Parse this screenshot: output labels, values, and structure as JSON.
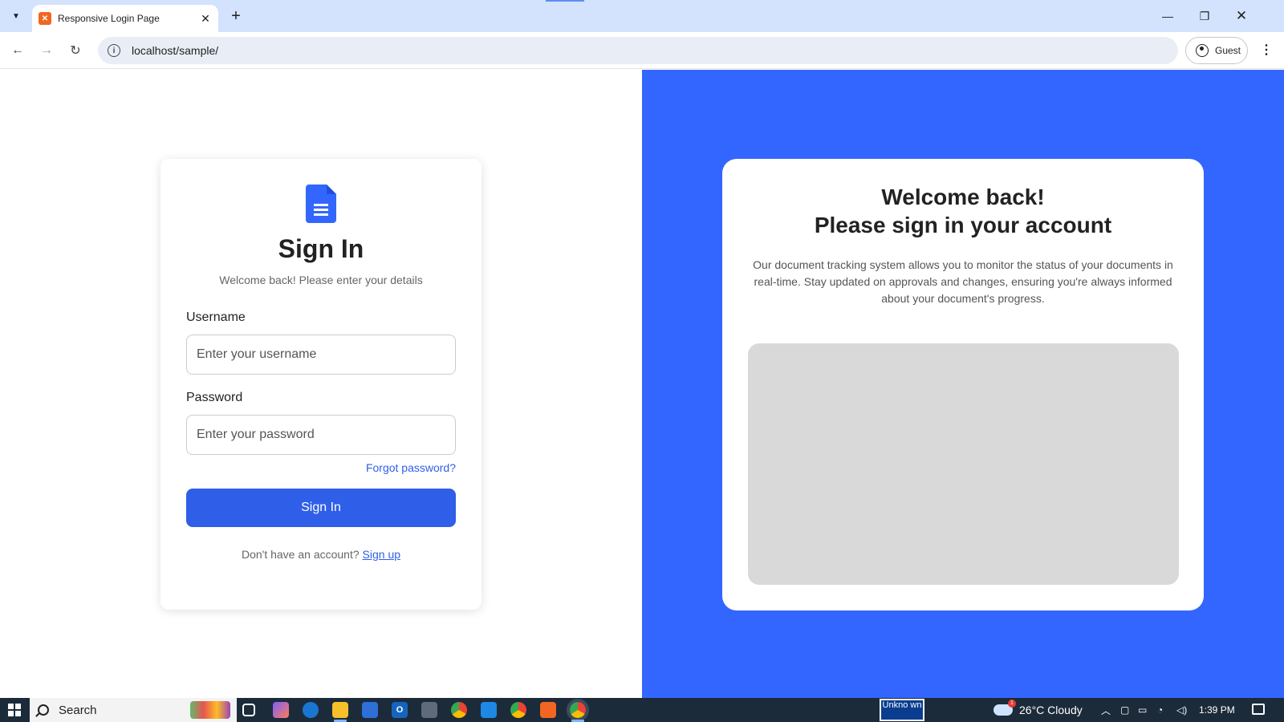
{
  "browser": {
    "tab_title": "Responsive Login Page",
    "tab_favicon": "xampp-icon",
    "url": "localhost/sample/",
    "profile_label": "Guest"
  },
  "login": {
    "title": "Sign In",
    "subtitle": "Welcome back! Please enter your details",
    "username_label": "Username",
    "username_placeholder": "Enter your username",
    "username_value": "",
    "password_label": "Password",
    "password_placeholder": "Enter your password",
    "password_value": "",
    "forgot_label": "Forgot password?",
    "submit_label": "Sign In",
    "signup_prompt": "Don't have an account?",
    "signup_link": "Sign up"
  },
  "welcome": {
    "title_line1": "Welcome back!",
    "title_line2": "Please sign in your account",
    "description": "Our document tracking system allows you to monitor the status of your documents in real-time. Stay updated on approvals and changes, ensuring you're always informed about your document's progress."
  },
  "taskbar": {
    "search_label": "Search",
    "unknown_label": "Unkno wn",
    "weather_temp": "26°C",
    "weather_condition": "Cloudy",
    "weather_badge": "1",
    "time": "1:39 PM"
  },
  "colors": {
    "accent": "#2f5fe8",
    "right_pane": "#3366ff",
    "placeholder_block": "#d9d9d9"
  }
}
